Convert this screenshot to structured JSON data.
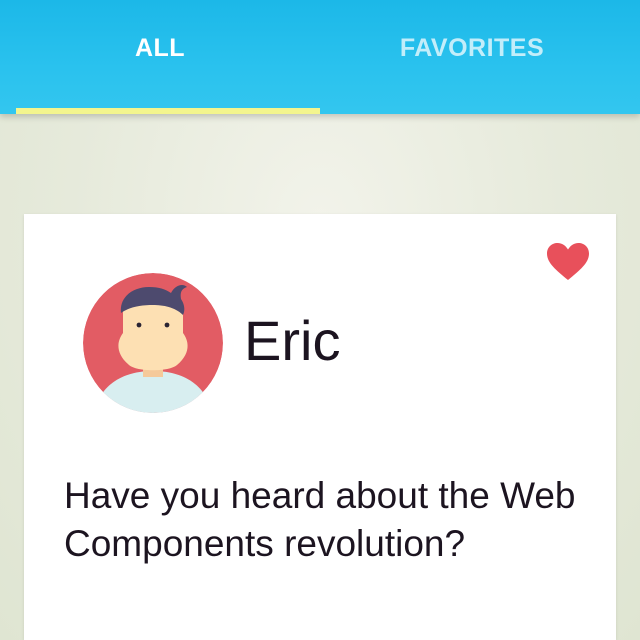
{
  "tabs": [
    {
      "label": "ALL",
      "selected": true
    },
    {
      "label": "FAVORITES",
      "selected": false
    }
  ],
  "colors": {
    "app_bar": "#1cb8e8",
    "tab_indicator": "#f3f58e",
    "heart": "#e8505b",
    "avatar_background": "#e25c64"
  },
  "card": {
    "name": "Eric",
    "message": "Have you heard about the Web Components revolution?",
    "favorite_icon": "heart-icon",
    "favorited": true,
    "avatar_icon": "avatar-illustration"
  }
}
